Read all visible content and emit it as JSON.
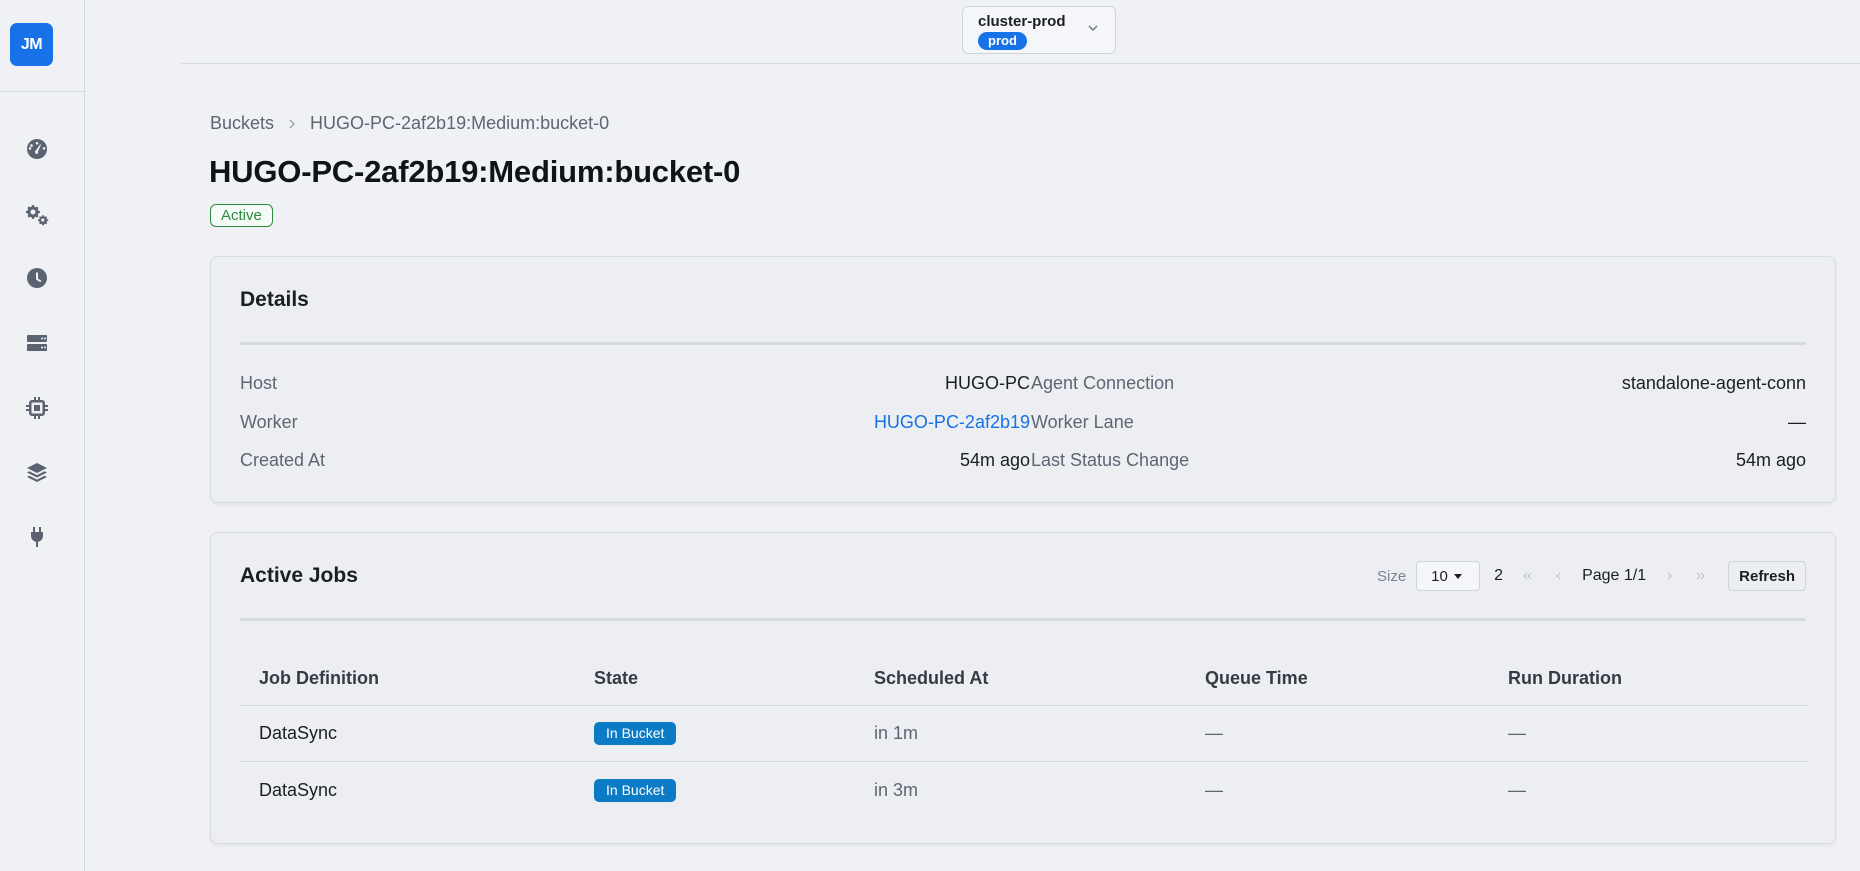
{
  "brand": {
    "logo_text": "JM",
    "accent": "#1672e6"
  },
  "sidebar": {
    "items": [
      {
        "icon": "dashboard-icon"
      },
      {
        "icon": "gears-icon"
      },
      {
        "icon": "clock-icon"
      },
      {
        "icon": "server-icon"
      },
      {
        "icon": "chip-icon"
      },
      {
        "icon": "layers-icon"
      },
      {
        "icon": "plug-icon"
      }
    ]
  },
  "header": {
    "cluster_name": "cluster-prod",
    "cluster_env": "prod"
  },
  "breadcrumb": {
    "root": "Buckets",
    "current": "HUGO-PC-2af2b19:Medium:bucket-0"
  },
  "page": {
    "title": "HUGO-PC-2af2b19:Medium:bucket-0",
    "status": "Active",
    "status_color": "#2f8a3e"
  },
  "details": {
    "title": "Details",
    "host_label": "Host",
    "host_value": "HUGO-PC",
    "worker_label": "Worker",
    "worker_value": "HUGO-PC-2af2b19",
    "created_label": "Created At",
    "created_value": "54m ago",
    "agent_label": "Agent Connection",
    "agent_value": "standalone-agent-conn",
    "lane_label": "Worker Lane",
    "lane_value": "—",
    "status_change_label": "Last Status Change",
    "status_change_value": "54m ago"
  },
  "jobs": {
    "title": "Active Jobs",
    "size_label": "Size",
    "size_value": "10",
    "total": "2",
    "page_info": "Page 1/1",
    "refresh_label": "Refresh",
    "columns": [
      "Job Definition",
      "State",
      "Scheduled At",
      "Queue Time",
      "Run Duration"
    ],
    "rows": [
      {
        "job": "DataSync",
        "state": "In Bucket",
        "scheduled": "in 1m",
        "queue": "—",
        "duration": "—"
      },
      {
        "job": "DataSync",
        "state": "In Bucket",
        "scheduled": "in 3m",
        "queue": "—",
        "duration": "—"
      }
    ],
    "state_color": "#0a7bc4"
  }
}
